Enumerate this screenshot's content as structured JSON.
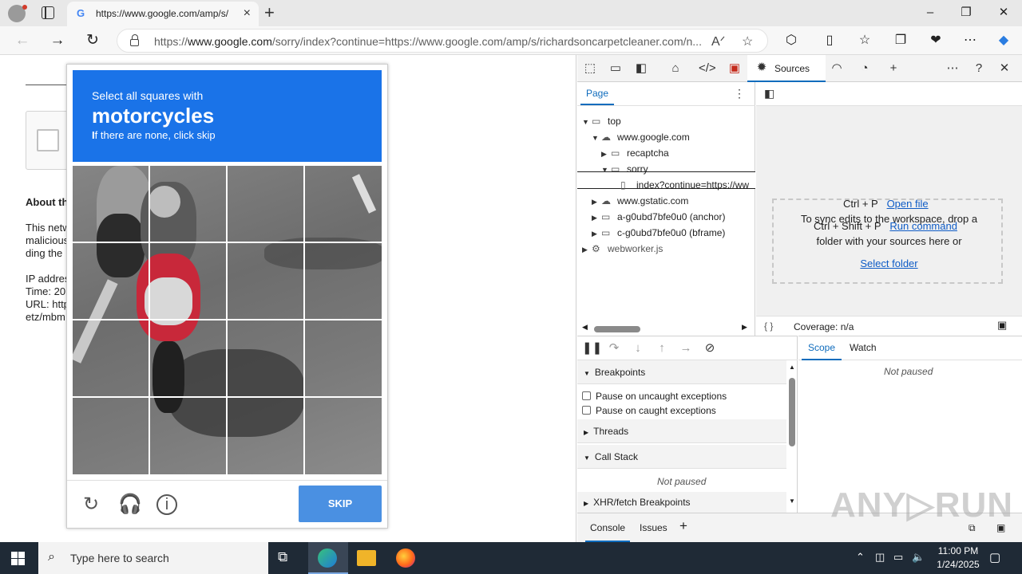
{
  "browser": {
    "tab_title": "https://www.google.com/amp/s/",
    "tab_favicon": "G",
    "url_domain": "www.google.com",
    "url_prefix": "https://",
    "url_rest": "/sorry/index?continue=https://www.google.com/amp/s/richardsoncarpetcleaner.com/n...",
    "window_controls": {
      "minimize": "–",
      "maximize": "❐",
      "close": "✕"
    }
  },
  "page": {
    "about_title": "About th",
    "lines": [
      "This netw",
      "malicious",
      "ding the",
      "",
      "IP addres",
      "Time: 20",
      "URL: http",
      "etz/mbm"
    ]
  },
  "captcha": {
    "line1": "Select all squares with",
    "keyword": "motorcycles",
    "line3_bold": "I",
    "line3": "f there are none, click skip",
    "skip_label": "SKIP",
    "icons": {
      "reload": "reload-icon",
      "audio": "headphones-icon",
      "info": "info-icon"
    }
  },
  "devtools": {
    "active_tab": "Sources",
    "page_tab": "Page",
    "tree": [
      {
        "label": "top",
        "arrow": "▼",
        "icon": "▭",
        "level": 0
      },
      {
        "label": "www.google.com",
        "arrow": "▼",
        "icon": "☁",
        "level": 1
      },
      {
        "label": "recaptcha",
        "arrow": "▶",
        "icon": "▭",
        "level": 2
      },
      {
        "label": "sorry",
        "arrow": "▼",
        "icon": "▭",
        "level": 2
      },
      {
        "label": "index?continue=https://ww",
        "arrow": "",
        "icon": "▯",
        "level": 3
      },
      {
        "label": "www.gstatic.com",
        "arrow": "▶",
        "icon": "☁",
        "level": 1
      },
      {
        "label": "a-g0ubd7bfe0u0 (anchor)",
        "arrow": "▶",
        "icon": "▭",
        "level": 1
      },
      {
        "label": "c-g0ubd7bfe0u0 (bframe)",
        "arrow": "▶",
        "icon": "▭",
        "level": 1
      },
      {
        "label": "webworker.js",
        "arrow": "▶",
        "icon": "⚙",
        "level": 0
      }
    ],
    "shortcut1_keys": "Ctrl + P",
    "shortcut1_action": "Open file",
    "shortcut2_keys": "Ctrl + Shift + P",
    "shortcut2_action": "Run command",
    "drop_line1": "To sync edits to the workspace, drop a",
    "drop_line2": "folder with your sources here or",
    "drop_link": "Select folder",
    "coverage": "Coverage: n/a",
    "format_icon": "{ }",
    "breakpoints": "Breakpoints",
    "pause_uncaught": "Pause on uncaught exceptions",
    "pause_caught": "Pause on caught exceptions",
    "threads": "Threads",
    "call_stack": "Call Stack",
    "not_paused": "Not paused",
    "xhr_breakpoints": "XHR/fetch Breakpoints",
    "scope_tab": "Scope",
    "watch_tab": "Watch",
    "drawer_console": "Console",
    "drawer_issues": "Issues"
  },
  "watermark": "ANY▷RUN",
  "taskbar": {
    "search_placeholder": "Type here to search",
    "time": "11:00 PM",
    "date": "1/24/2025"
  }
}
